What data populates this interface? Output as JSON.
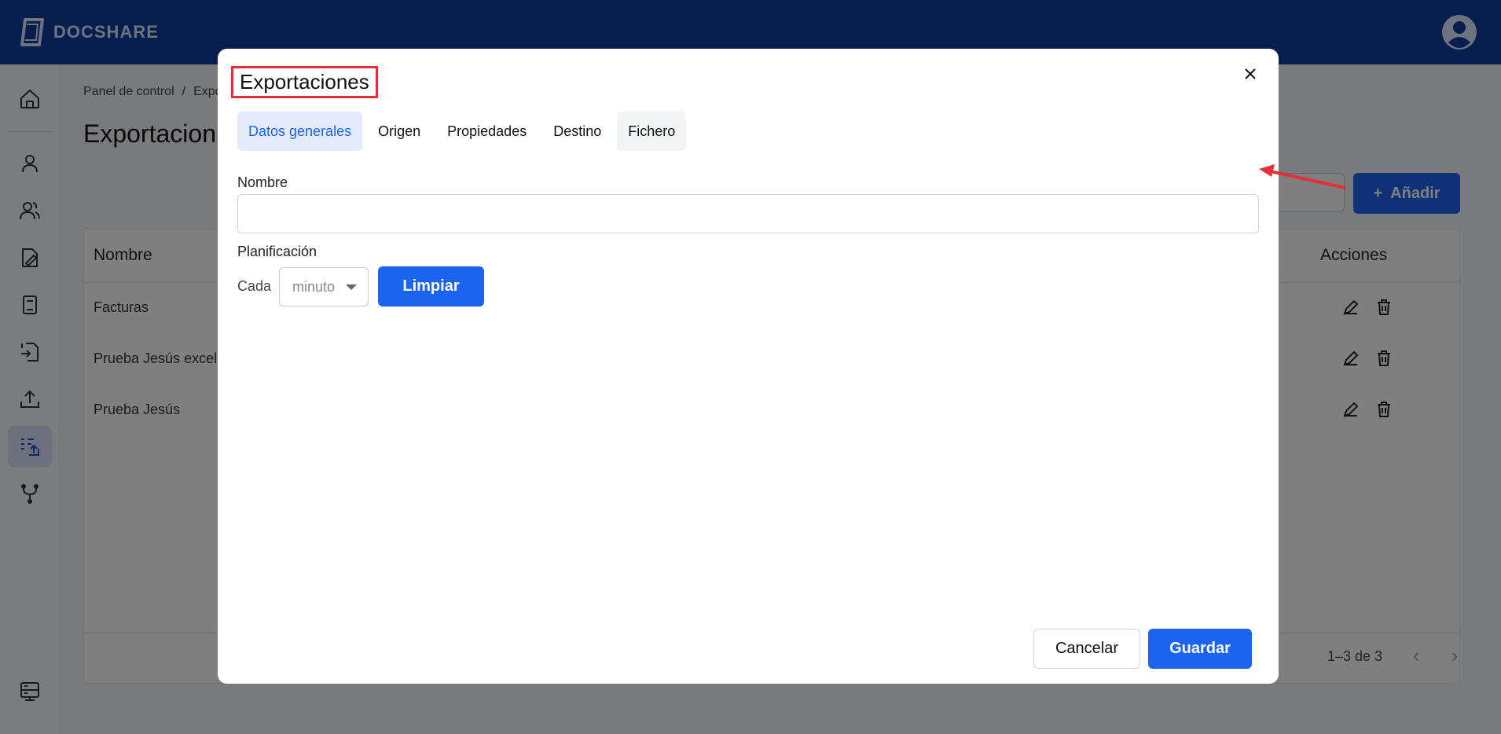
{
  "app": {
    "name": "DOCSHARE"
  },
  "breadcrumb": {
    "root": "Panel de control",
    "separator": "/",
    "current": "Expo"
  },
  "page": {
    "title": "Exportacion"
  },
  "toolbar": {
    "add_label": "Añadir"
  },
  "table": {
    "headers": {
      "name": "Nombre",
      "actions": "Acciones"
    },
    "rows": [
      {
        "name": "Facturas"
      },
      {
        "name": "Prueba Jesús excel"
      },
      {
        "name": "Prueba Jesús"
      }
    ],
    "pagination": "1–3 de 3"
  },
  "sidebar": {
    "items": [
      {
        "icon": "home-icon"
      },
      {
        "icon": "user-icon"
      },
      {
        "icon": "users-icon"
      },
      {
        "icon": "document-edit-icon"
      },
      {
        "icon": "book-icon"
      },
      {
        "icon": "import-icon"
      },
      {
        "icon": "upload-icon"
      },
      {
        "icon": "export-list-icon",
        "active": true
      },
      {
        "icon": "workflow-icon"
      },
      {
        "icon": "server-icon"
      }
    ]
  },
  "modal": {
    "title": "Exportaciones",
    "tabs": [
      {
        "label": "Datos generales",
        "active": true
      },
      {
        "label": "Origen"
      },
      {
        "label": "Propiedades"
      },
      {
        "label": "Destino"
      },
      {
        "label": "Fichero"
      }
    ],
    "name_label": "Nombre",
    "name_value": "",
    "schedule_label": "Planificación",
    "every_label": "Cada",
    "interval_value": "minuto",
    "clear_label": "Limpiar",
    "cancel_label": "Cancelar",
    "save_label": "Guardar"
  },
  "colors": {
    "brand": "#0f3b9c",
    "accent": "#1c63f0",
    "highlight": "#e0303a"
  }
}
